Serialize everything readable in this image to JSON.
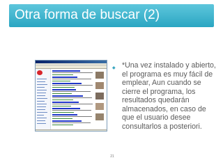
{
  "slide": {
    "title": "Otra forma de buscar (2)",
    "bullet_icon": "bullet-diamond-icon",
    "bullet_text": "*Una vez instalado y abierto, el programa es muy fácil de emplear, Aun cuando se cierre el programa, los resultados quedarán almacenados, en caso de que el usuario desee consultarlos a posteriori.",
    "page_number": "21"
  },
  "colors": {
    "title_bar": "#2aa6c2",
    "title_text": "#ffffff",
    "body_text": "#5a5a5a",
    "accent": "#3aa6c0"
  }
}
